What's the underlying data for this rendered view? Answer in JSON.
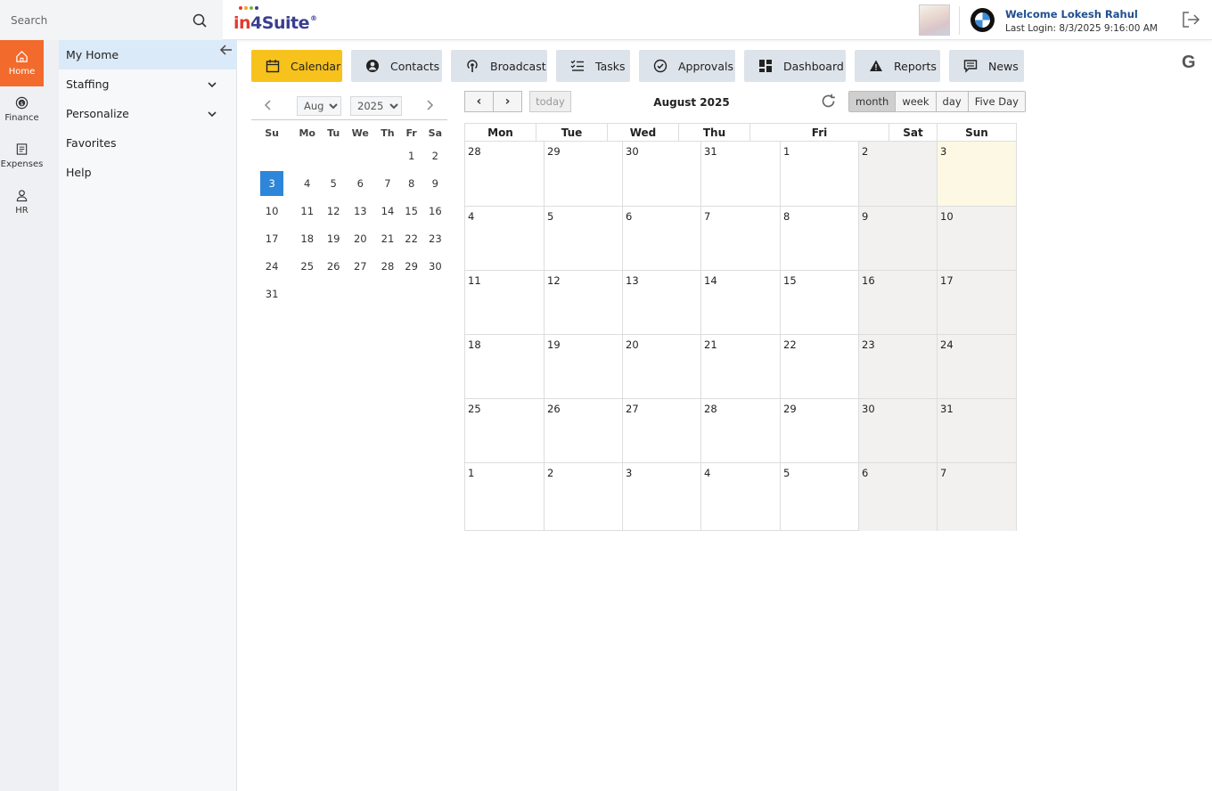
{
  "search": {
    "placeholder": "Search"
  },
  "logo": {
    "part1": "in",
    "part2": "4Suite",
    "mark": "®"
  },
  "user": {
    "welcome": "Welcome Lokesh Rahul",
    "last_login": "Last Login: 8/3/2025 9:16:00 AM"
  },
  "rail": [
    {
      "label": "Home",
      "icon": "home-icon"
    },
    {
      "label": "Finance",
      "icon": "coin-icon"
    },
    {
      "label": "Expenses",
      "icon": "receipt-icon"
    },
    {
      "label": "HR",
      "icon": "person-icon"
    }
  ],
  "menu": [
    {
      "label": "My Home"
    },
    {
      "label": "Staffing"
    },
    {
      "label": "Personalize"
    },
    {
      "label": "Favorites"
    },
    {
      "label": "Help"
    }
  ],
  "tabs": [
    {
      "label": "Calendar",
      "icon": "calendar-icon"
    },
    {
      "label": "Contacts",
      "icon": "contact-icon"
    },
    {
      "label": "Broadcast",
      "icon": "broadcast-icon"
    },
    {
      "label": "Tasks",
      "icon": "tasks-icon"
    },
    {
      "label": "Approvals",
      "icon": "check-circle-icon"
    },
    {
      "label": "Dashboard",
      "icon": "dashboard-icon"
    },
    {
      "label": "Reports",
      "icon": "warning-icon"
    },
    {
      "label": "News",
      "icon": "news-icon"
    }
  ],
  "g_icon": "G",
  "mini_calendar": {
    "month": "Aug",
    "year": "2025",
    "weekdays": [
      "Su",
      "Mo",
      "Tu",
      "We",
      "Th",
      "Fr",
      "Sa"
    ],
    "weeks": [
      [
        "",
        "",
        "",
        "",
        "",
        "1",
        "2"
      ],
      [
        "3",
        "4",
        "5",
        "6",
        "7",
        "8",
        "9"
      ],
      [
        "10",
        "11",
        "12",
        "13",
        "14",
        "15",
        "16"
      ],
      [
        "17",
        "18",
        "19",
        "20",
        "21",
        "22",
        "23"
      ],
      [
        "24",
        "25",
        "26",
        "27",
        "28",
        "29",
        "30"
      ],
      [
        "31",
        "",
        "",
        "",
        "",
        "",
        ""
      ]
    ],
    "selected": "3"
  },
  "calendar": {
    "prev": "‹",
    "next": "›",
    "today_label": "today",
    "title": "August 2025",
    "views": [
      "month",
      "week",
      "day",
      "Five Day"
    ],
    "active_view": "month",
    "weekdays": [
      "Mon",
      "Tue",
      "Wed",
      "Thu",
      "Fri",
      "Sat",
      "Sun"
    ],
    "weeks": [
      [
        "28",
        "29",
        "30",
        "31",
        "1",
        "2",
        "3"
      ],
      [
        "4",
        "5",
        "6",
        "7",
        "8",
        "9",
        "10"
      ],
      [
        "11",
        "12",
        "13",
        "14",
        "15",
        "16",
        "17"
      ],
      [
        "18",
        "19",
        "20",
        "21",
        "22",
        "23",
        "24"
      ],
      [
        "25",
        "26",
        "27",
        "28",
        "29",
        "30",
        "31"
      ],
      [
        "1",
        "2",
        "3",
        "4",
        "5",
        "6",
        "7"
      ]
    ],
    "today": "3"
  },
  "colors": {
    "accent_orange": "#f26b2c",
    "tab_active": "#f8c21c",
    "selected_blue": "#2d86d9",
    "today_bg": "#fcf8e3"
  }
}
